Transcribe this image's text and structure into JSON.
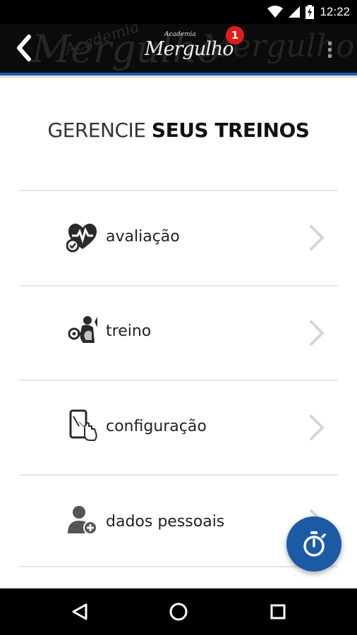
{
  "status_bar": {
    "time": "12:22"
  },
  "app_bar": {
    "logo_small": "Academia",
    "logo_main": "Mergulho",
    "notification_count": "1",
    "background_words": [
      "Academia",
      "Mergulho"
    ]
  },
  "page": {
    "title_light": "GERENCIE",
    "title_bold": "SEUS TREINOS"
  },
  "menu": {
    "items": [
      {
        "label": "avaliação",
        "icon": "heart-check-icon"
      },
      {
        "label": "treino",
        "icon": "bodybuilder-icon"
      },
      {
        "label": "configuração",
        "icon": "phone-touch-icon"
      },
      {
        "label": "dados pessoais",
        "icon": "add-user-icon"
      }
    ]
  },
  "fab": {
    "icon": "stopwatch-icon",
    "color": "#1d5aa6"
  },
  "colors": {
    "accent": "#1f5fae",
    "badge": "#e21b1b"
  }
}
